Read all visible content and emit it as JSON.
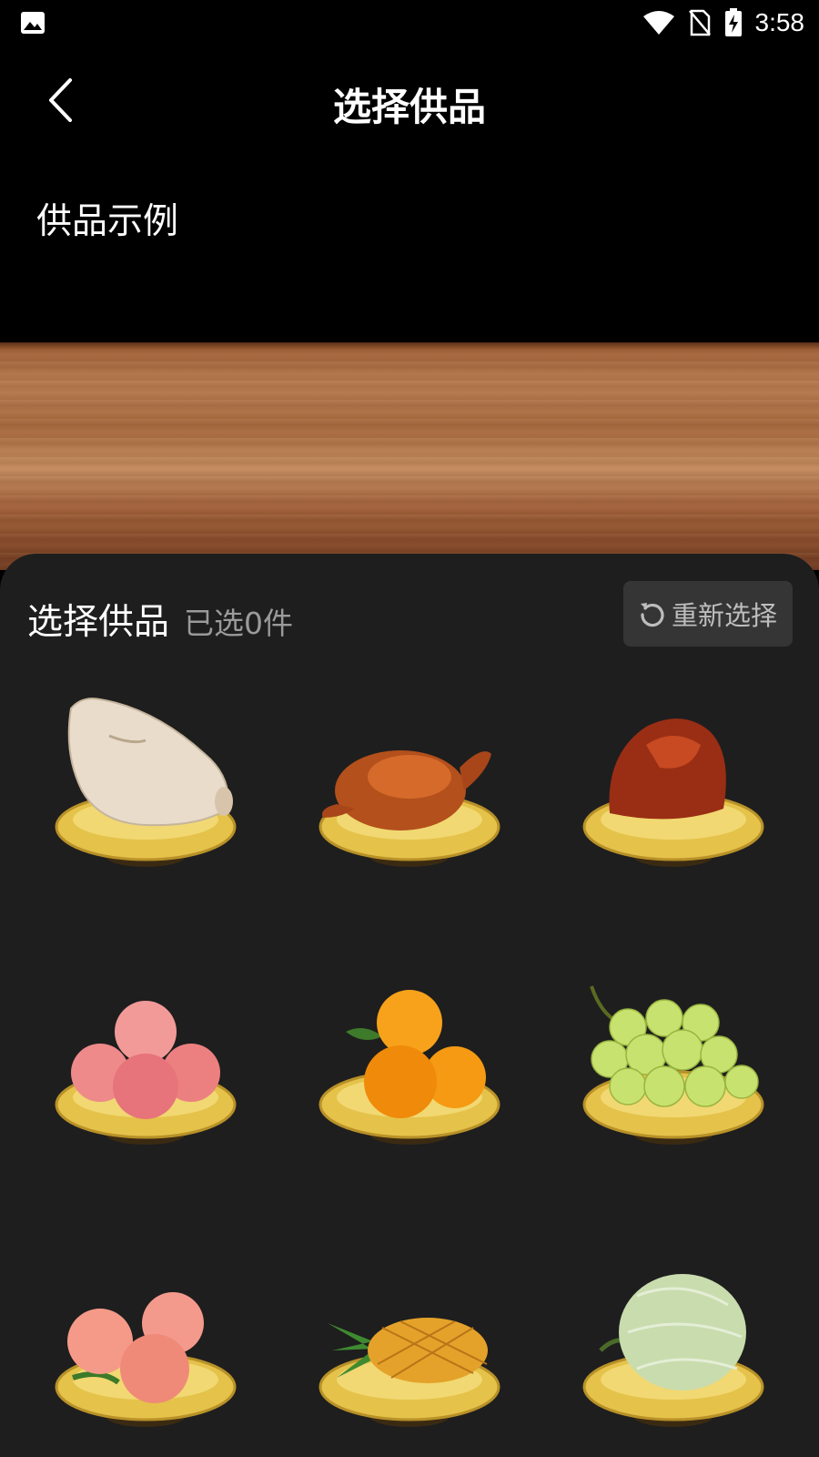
{
  "status_bar": {
    "time": "3:58"
  },
  "nav": {
    "title": "选择供品"
  },
  "example_label": "供品示例",
  "panel": {
    "title": "选择供品",
    "selected_count": "已选0件",
    "reset_label": "重新选择"
  },
  "offerings": [
    {
      "icon": "pig-head-icon"
    },
    {
      "icon": "roast-chicken-icon"
    },
    {
      "icon": "braised-pork-icon"
    },
    {
      "icon": "apples-icon"
    },
    {
      "icon": "oranges-icon"
    },
    {
      "icon": "grapes-icon"
    },
    {
      "icon": "peaches-icon"
    },
    {
      "icon": "pineapple-icon"
    },
    {
      "icon": "melon-icon"
    }
  ],
  "colors": {
    "background": "#000000",
    "panel": "#1e1e1e",
    "reset_button": "#353535",
    "count_text": "#9a9a9a",
    "plate_gold": "#e5c24a"
  }
}
